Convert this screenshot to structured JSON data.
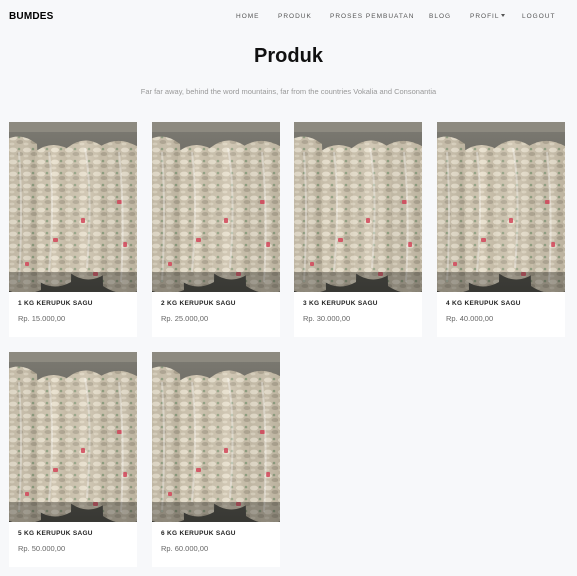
{
  "brand": "BUMDES",
  "nav": [
    {
      "label": "HOME",
      "name": "nav-home"
    },
    {
      "label": "PRODUK",
      "name": "nav-produk"
    },
    {
      "label": "PROSES PEMBUATAN",
      "name": "nav-proses-pembuatan"
    },
    {
      "label": "BLOG",
      "name": "nav-blog"
    },
    {
      "label": "PROFIL",
      "name": "nav-profil",
      "dropdown": true
    },
    {
      "label": "LOGOUT",
      "name": "nav-logout"
    }
  ],
  "page": {
    "title": "Produk",
    "subtitle": "Far far away, behind the word mountains, far from the countries Vokalia and Consonantia"
  },
  "products": [
    {
      "name": "1 KG KERUPUK SAGU",
      "price": "Rp. 15.000,00"
    },
    {
      "name": "2 KG KERUPUK SAGU",
      "price": "Rp. 25.000,00"
    },
    {
      "name": "3 KG KERUPUK SAGU",
      "price": "Rp. 30.000,00"
    },
    {
      "name": "4 KG KERUPUK SAGU",
      "price": "Rp. 40.000,00"
    },
    {
      "name": "5 KG KERUPUK SAGU",
      "price": "Rp. 50.000,00"
    },
    {
      "name": "6 KG KERUPUK SAGU",
      "price": "Rp. 60.000,00"
    }
  ],
  "colors": {
    "background": "#f7f8fa",
    "card": "#ffffff",
    "text": "#222222",
    "muted": "#999999"
  },
  "icons": {
    "dropdown": "chevron-down-icon"
  }
}
